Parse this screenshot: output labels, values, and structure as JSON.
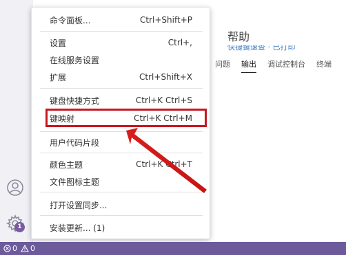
{
  "activity_bar": {
    "icons": [
      "account-icon",
      "gear-icon"
    ],
    "update_badge": "1"
  },
  "help_panel": {
    "title": "帮助",
    "subtitle": "快捷键速查 · 已打印"
  },
  "panel": {
    "tabs": [
      {
        "label": "问题",
        "active": false
      },
      {
        "label": "输出",
        "active": true
      },
      {
        "label": "调试控制台",
        "active": false
      },
      {
        "label": "终端",
        "active": false
      }
    ]
  },
  "menu": {
    "items": [
      {
        "label": "命令面板...",
        "shortcut": "Ctrl+Shift+P"
      },
      {
        "label": "设置",
        "shortcut": "Ctrl+,"
      },
      {
        "label": "在线服务设置",
        "shortcut": ""
      },
      {
        "label": "扩展",
        "shortcut": "Ctrl+Shift+X"
      },
      {
        "label": "键盘快捷方式",
        "shortcut": "Ctrl+K Ctrl+S"
      },
      {
        "label": "键映射",
        "shortcut": "Ctrl+K Ctrl+M"
      },
      {
        "label": "用户代码片段",
        "shortcut": ""
      },
      {
        "label": "颜色主题",
        "shortcut": "Ctrl+K Ctrl+T"
      },
      {
        "label": "文件图标主题",
        "shortcut": ""
      },
      {
        "label": "打开设置同步...",
        "shortcut": ""
      },
      {
        "label": "安装更新... (1)",
        "shortcut": ""
      }
    ],
    "highlighted_item": "键映射"
  },
  "statusbar": {
    "errors": "0",
    "warnings": "0",
    "color": "#6c5a9b"
  },
  "colors": {
    "highlight": "#c8141e",
    "badge": "#7a5aa0"
  }
}
